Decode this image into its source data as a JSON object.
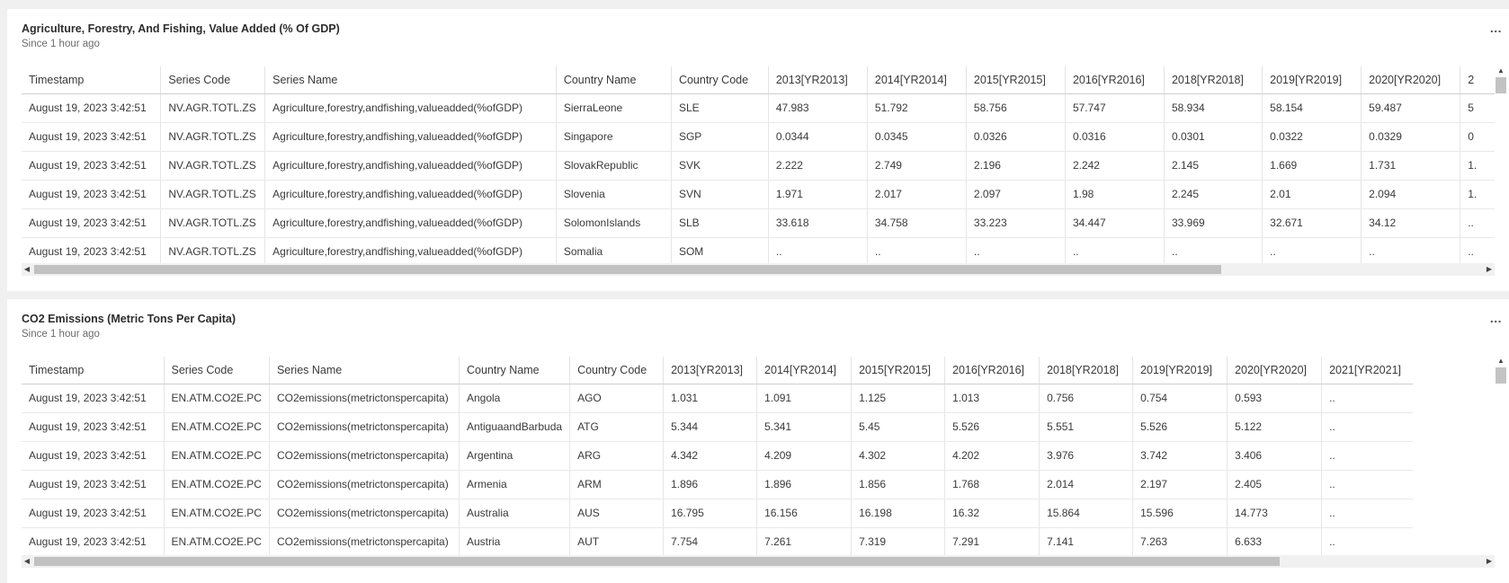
{
  "panels": [
    {
      "title": "Agriculture, Forestry, And Fishing, Value Added (% Of GDP)",
      "subtitle": "Since 1 hour ago",
      "menu": "...",
      "columns": [
        "Timestamp",
        "Series Code",
        "Series Name",
        "Country Name",
        "Country Code",
        "2013[YR2013]",
        "2014[YR2014]",
        "2015[YR2015]",
        "2016[YR2016]",
        "2018[YR2018]",
        "2019[YR2019]",
        "2020[YR2020]",
        "2"
      ],
      "rows": [
        [
          "August 19, 2023 3:42:51",
          "NV.AGR.TOTL.ZS",
          "Agriculture,forestry,andfishing,valueadded(%ofGDP)",
          "SierraLeone",
          "SLE",
          "47.983",
          "51.792",
          "58.756",
          "57.747",
          "58.934",
          "58.154",
          "59.487",
          "5"
        ],
        [
          "August 19, 2023 3:42:51",
          "NV.AGR.TOTL.ZS",
          "Agriculture,forestry,andfishing,valueadded(%ofGDP)",
          "Singapore",
          "SGP",
          "0.0344",
          "0.0345",
          "0.0326",
          "0.0316",
          "0.0301",
          "0.0322",
          "0.0329",
          "0"
        ],
        [
          "August 19, 2023 3:42:51",
          "NV.AGR.TOTL.ZS",
          "Agriculture,forestry,andfishing,valueadded(%ofGDP)",
          "SlovakRepublic",
          "SVK",
          "2.222",
          "2.749",
          "2.196",
          "2.242",
          "2.145",
          "1.669",
          "1.731",
          "1."
        ],
        [
          "August 19, 2023 3:42:51",
          "NV.AGR.TOTL.ZS",
          "Agriculture,forestry,andfishing,valueadded(%ofGDP)",
          "Slovenia",
          "SVN",
          "1.971",
          "2.017",
          "2.097",
          "1.98",
          "2.245",
          "2.01",
          "2.094",
          "1."
        ],
        [
          "August 19, 2023 3:42:51",
          "NV.AGR.TOTL.ZS",
          "Agriculture,forestry,andfishing,valueadded(%ofGDP)",
          "SolomonIslands",
          "SLB",
          "33.618",
          "34.758",
          "33.223",
          "34.447",
          "33.969",
          "32.671",
          "34.12",
          ".."
        ],
        [
          "August 19, 2023 3:42:51",
          "NV.AGR.TOTL.ZS",
          "Agriculture,forestry,andfishing,valueadded(%ofGDP)",
          "Somalia",
          "SOM",
          "..",
          "..",
          "..",
          "..",
          "..",
          "..",
          "..",
          ".."
        ]
      ],
      "scroll": {
        "horizontal_visible_fraction": 0.82,
        "vertical_visible_fraction": 0.08
      }
    },
    {
      "title": "CO2 Emissions (Metric Tons Per Capita)",
      "subtitle": "Since 1 hour ago",
      "menu": "...",
      "columns": [
        "Timestamp",
        "Series Code",
        "Series Name",
        "Country Name",
        "Country Code",
        "2013[YR2013]",
        "2014[YR2014]",
        "2015[YR2015]",
        "2016[YR2016]",
        "2018[YR2018]",
        "2019[YR2019]",
        "2020[YR2020]",
        "2021[YR2021]"
      ],
      "rows": [
        [
          "August 19, 2023 3:42:51",
          "EN.ATM.CO2E.PC",
          "CO2emissions(metrictonspercapita)",
          "Angola",
          "AGO",
          "1.031",
          "1.091",
          "1.125",
          "1.013",
          "0.756",
          "0.754",
          "0.593",
          ".."
        ],
        [
          "August 19, 2023 3:42:51",
          "EN.ATM.CO2E.PC",
          "CO2emissions(metrictonspercapita)",
          "AntiguaandBarbuda",
          "ATG",
          "5.344",
          "5.341",
          "5.45",
          "5.526",
          "5.551",
          "5.526",
          "5.122",
          ".."
        ],
        [
          "August 19, 2023 3:42:51",
          "EN.ATM.CO2E.PC",
          "CO2emissions(metrictonspercapita)",
          "Argentina",
          "ARG",
          "4.342",
          "4.209",
          "4.302",
          "4.202",
          "3.976",
          "3.742",
          "3.406",
          ".."
        ],
        [
          "August 19, 2023 3:42:51",
          "EN.ATM.CO2E.PC",
          "CO2emissions(metrictonspercapita)",
          "Armenia",
          "ARM",
          "1.896",
          "1.896",
          "1.856",
          "1.768",
          "2.014",
          "2.197",
          "2.405",
          ".."
        ],
        [
          "August 19, 2023 3:42:51",
          "EN.ATM.CO2E.PC",
          "CO2emissions(metrictonspercapita)",
          "Australia",
          "AUS",
          "16.795",
          "16.156",
          "16.198",
          "16.32",
          "15.864",
          "15.596",
          "14.773",
          ".."
        ],
        [
          "August 19, 2023 3:42:51",
          "EN.ATM.CO2E.PC",
          "CO2emissions(metrictonspercapita)",
          "Austria",
          "AUT",
          "7.754",
          "7.261",
          "7.319",
          "7.291",
          "7.141",
          "7.263",
          "6.633",
          ".."
        ]
      ],
      "scroll": {
        "horizontal_visible_fraction": 0.86,
        "vertical_visible_fraction": 0.08
      }
    }
  ]
}
